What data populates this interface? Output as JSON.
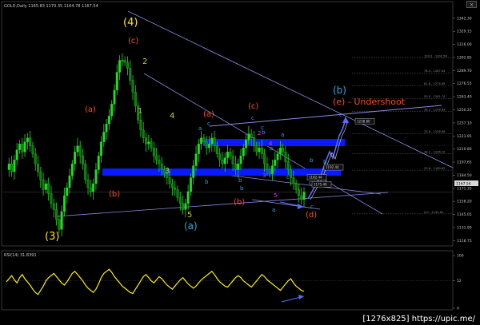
{
  "price_panel": {
    "title": "GOLD,Daily  1165.83 1170.35 1164.78 1167.54",
    "ylim": [
      1115,
      1351
    ],
    "current_price": "1167.54",
    "price_ticks": [
      "1342.30",
      "1329.15",
      "1316.00",
      "1302.85",
      "1289.70",
      "1276.55",
      "1263.40",
      "1250.25",
      "1237.10",
      "1223.95",
      "1210.80",
      "1197.65",
      "1184.50",
      "1171.35",
      "1158.20",
      "1145.05",
      "1131.90",
      "1118.75"
    ],
    "fib_levels": [
      {
        "price": 1302.5,
        "label": "100.0 - 1302.56"
      },
      {
        "price": 1287.4,
        "label": "76.4 - 1287.44"
      },
      {
        "price": 1274.6,
        "label": "61.8 - 1274.65"
      },
      {
        "price": 1261.7,
        "label": "50.0 - 1261.74"
      },
      {
        "price": 1248.8,
        "label": "38.2 - 1248.83"
      },
      {
        "price": 1226.4,
        "label": "23.6 - 1226.46"
      },
      {
        "price": 1206.1,
        "label": "38.2 - 1206.10"
      },
      {
        "price": 1189.6,
        "label": "23.6 - 1189.62"
      },
      {
        "price": 1145.6,
        "label": "0.0 - 1145.61"
      }
    ],
    "price_boxes": [
      {
        "price": 1238.8,
        "label": "1238.80"
      },
      {
        "price": 1192.4,
        "label": "1192.44"
      },
      {
        "price": 1182.4,
        "label": "1182.44"
      },
      {
        "price": 1175.4,
        "label": "1175.40"
      }
    ],
    "wave_labels": [
      {
        "text": "(4)",
        "color": "#ffe600",
        "size": 13
      },
      {
        "text": "(3)",
        "color": "#ffe600",
        "size": 13
      },
      {
        "text": "(c)",
        "color": "#ff4a1a",
        "size": 10
      },
      {
        "text": "2",
        "color": "#c8c832",
        "size": 10
      },
      {
        "text": "1",
        "color": "#c8c832",
        "size": 10
      },
      {
        "text": "4",
        "color": "#c8c832",
        "size": 10
      },
      {
        "text": "3",
        "color": "#c8c832",
        "size": 10
      },
      {
        "text": "5",
        "color": "#c8c832",
        "size": 10
      },
      {
        "text": "(a)",
        "color": "#ff4a1a",
        "size": 10
      },
      {
        "text": "(b)",
        "color": "#ff4a1a",
        "size": 10
      },
      {
        "text": "(a)",
        "color": "#ff4a1a",
        "size": 10
      },
      {
        "text": "(c)",
        "color": "#ff4a1a",
        "size": 10
      },
      {
        "text": "(b)",
        "color": "#ff4a1a",
        "size": 10
      },
      {
        "text": "(d)",
        "color": "#ff4a1a",
        "size": 10
      },
      {
        "text": "(e) - Undershoot",
        "color": "#ff4a1a",
        "size": 11
      },
      {
        "text": "(b)",
        "color": "#29a8e0",
        "size": 12
      },
      {
        "text": "(a)",
        "color": "#29a8e0",
        "size": 12
      },
      {
        "text": "a",
        "color": "#29a8e0",
        "size": 7
      },
      {
        "text": "c",
        "color": "#29a8e0",
        "size": 7
      },
      {
        "text": "b",
        "color": "#29a8e0",
        "size": 7
      },
      {
        "text": "b",
        "color": "#29a8e0",
        "size": 7
      },
      {
        "text": "c",
        "color": "#29a8e0",
        "size": 7
      },
      {
        "text": "b",
        "color": "#29a8e0",
        "size": 7
      },
      {
        "text": "c",
        "color": "#29a8e0",
        "size": 7
      },
      {
        "text": "b",
        "color": "#29a8e0",
        "size": 7
      },
      {
        "text": "a",
        "color": "#29a8e0",
        "size": 7
      },
      {
        "text": "c",
        "color": "#29a8e0",
        "size": 7
      },
      {
        "text": "a",
        "color": "#29a8e0",
        "size": 7
      },
      {
        "text": "a",
        "color": "#29a8e0",
        "size": 7
      },
      {
        "text": "b",
        "color": "#29a8e0",
        "size": 7
      },
      {
        "text": "c",
        "color": "#29a8e0",
        "size": 7
      },
      {
        "text": "c",
        "color": "#29a8e0",
        "size": 7
      },
      {
        "text": "b",
        "color": "#29a8e0",
        "size": 7
      },
      {
        "text": "c",
        "color": "#29a8e0",
        "size": 7
      },
      {
        "text": "2",
        "color": "#ff33ff",
        "size": 7
      },
      {
        "text": "4",
        "color": "#ff33ff",
        "size": 7
      },
      {
        "text": "3",
        "color": "#ff33ff",
        "size": 7
      },
      {
        "text": "5",
        "color": "#ff33ff",
        "size": 7
      }
    ]
  },
  "rsi_panel": {
    "title": "RSI(14) 31.8391",
    "ylim": [
      0,
      100
    ],
    "ticks": [
      "100",
      "52",
      "0"
    ]
  },
  "watermark": "[1276x825] https://upic.me/",
  "close_button_label": "×",
  "colors": {
    "background": "#000000",
    "candle": "#22dd22",
    "channel_line": "#8a8ae8",
    "zone": "#0a1aff",
    "rsi_line": "#ffee00",
    "projection": "#5a6aff"
  },
  "chart_data": {
    "type": "candlestick",
    "title": "GOLD,Daily",
    "ylim": [
      1115,
      1351
    ],
    "close_path": [
      1190,
      1196,
      1188,
      1200,
      1210,
      1216,
      1208,
      1218,
      1222,
      1214,
      1206,
      1196,
      1188,
      1180,
      1170,
      1176,
      1166,
      1156,
      1150,
      1140,
      1130,
      1148,
      1164,
      1172,
      1184,
      1196,
      1208,
      1214,
      1204,
      1196,
      1180,
      1172,
      1168,
      1176,
      1190,
      1204,
      1218,
      1228,
      1236,
      1244,
      1256,
      1270,
      1288,
      1300,
      1300,
      1298,
      1292,
      1280,
      1268,
      1254,
      1240,
      1230,
      1222,
      1216,
      1218,
      1212,
      1204,
      1200,
      1196,
      1190,
      1186,
      1182,
      1176,
      1172,
      1170,
      1162,
      1156,
      1150,
      1156,
      1168,
      1182,
      1194,
      1206,
      1216,
      1222,
      1218,
      1212,
      1216,
      1222,
      1214,
      1206,
      1200,
      1196,
      1202,
      1208,
      1204,
      1196,
      1190,
      1196,
      1204,
      1212,
      1220,
      1226,
      1222,
      1214,
      1208,
      1212,
      1206,
      1196,
      1190,
      1186,
      1194,
      1200,
      1206,
      1212,
      1208,
      1198,
      1190,
      1182,
      1176,
      1170,
      1164,
      1160,
      1167.54
    ],
    "rsi_path": [
      50,
      56,
      62,
      54,
      48,
      58,
      64,
      56,
      50,
      44,
      36,
      30,
      26,
      34,
      42,
      52,
      58,
      62,
      66,
      60,
      54,
      48,
      44,
      50,
      58,
      66,
      70,
      64,
      58,
      52,
      44,
      38,
      34,
      30,
      36,
      46,
      58,
      66,
      70,
      74,
      68,
      60,
      54,
      48,
      42,
      38,
      34,
      30,
      28,
      36,
      44,
      52,
      60,
      64,
      58,
      52,
      48,
      54,
      60,
      56,
      50,
      44,
      40,
      36,
      42,
      48,
      54,
      58,
      52,
      46,
      42,
      38,
      42,
      48,
      54,
      58,
      62,
      66,
      70,
      64,
      56,
      50,
      46,
      42,
      40,
      46,
      52,
      58,
      62,
      58,
      52,
      48,
      44,
      40,
      46,
      52,
      58,
      64,
      60,
      54,
      50,
      46,
      42,
      38,
      34,
      40,
      46,
      52,
      56,
      48,
      42,
      38,
      34,
      31.84
    ]
  }
}
